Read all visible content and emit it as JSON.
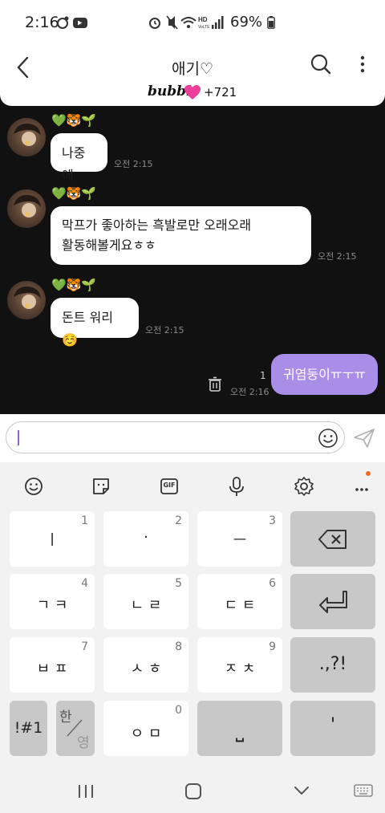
{
  "status_bar": {
    "time": "2:16",
    "battery": "69%"
  },
  "app_bar": {
    "title": "애기♡"
  },
  "bubble_bar": {
    "brand": "bubble",
    "count": "+721"
  },
  "messages": [
    {
      "sender_emojis": "💚🐯🌱",
      "lines": [
        "나중에"
      ],
      "time": "오전 2:15"
    },
    {
      "sender_emojis": "💚🐯🌱",
      "lines": [
        "막프가 좋아하는 흑발로만 오래오래",
        "활동해볼게요ㅎㅎ"
      ],
      "time": "오전 2:15"
    },
    {
      "sender_emojis": "💚🐯🌱",
      "lines": [
        "돈트 워리☺️"
      ],
      "time": "오전 2:15"
    }
  ],
  "sent_message": {
    "text": "귀염둥이ㅠㅜㅠ",
    "read_count": "1",
    "time": "오전 2:16"
  },
  "input": {
    "value": ""
  },
  "keyboard": {
    "toolbar": [
      "emoji-icon",
      "sticker-icon",
      "gif-icon",
      "mic-icon",
      "settings-icon",
      "more-icon"
    ],
    "gif_label": "GIF",
    "keys": [
      {
        "label": "ㅣ",
        "num": "1"
      },
      {
        "label": "·",
        "num": "2"
      },
      {
        "label": "ㅡ",
        "num": "3"
      },
      {
        "label": "ㄱ ㅋ",
        "num": "4"
      },
      {
        "label": "ㄴ ㄹ",
        "num": "5"
      },
      {
        "label": "ㄷ ㅌ",
        "num": "6"
      },
      {
        "label": "ㅂ ㅍ",
        "num": "7"
      },
      {
        "label": "ㅅ ㅎ",
        "num": "8"
      },
      {
        "label": "ㅈ ㅊ",
        "num": "9"
      },
      {
        "label": "ㅇ ㅁ",
        "num": "0"
      }
    ],
    "punct": ".,?!",
    "symbols": "!#1",
    "lang_top": "한",
    "lang_bottom": "영",
    "space_glyph": "⎵",
    "apostrophe": "'"
  }
}
